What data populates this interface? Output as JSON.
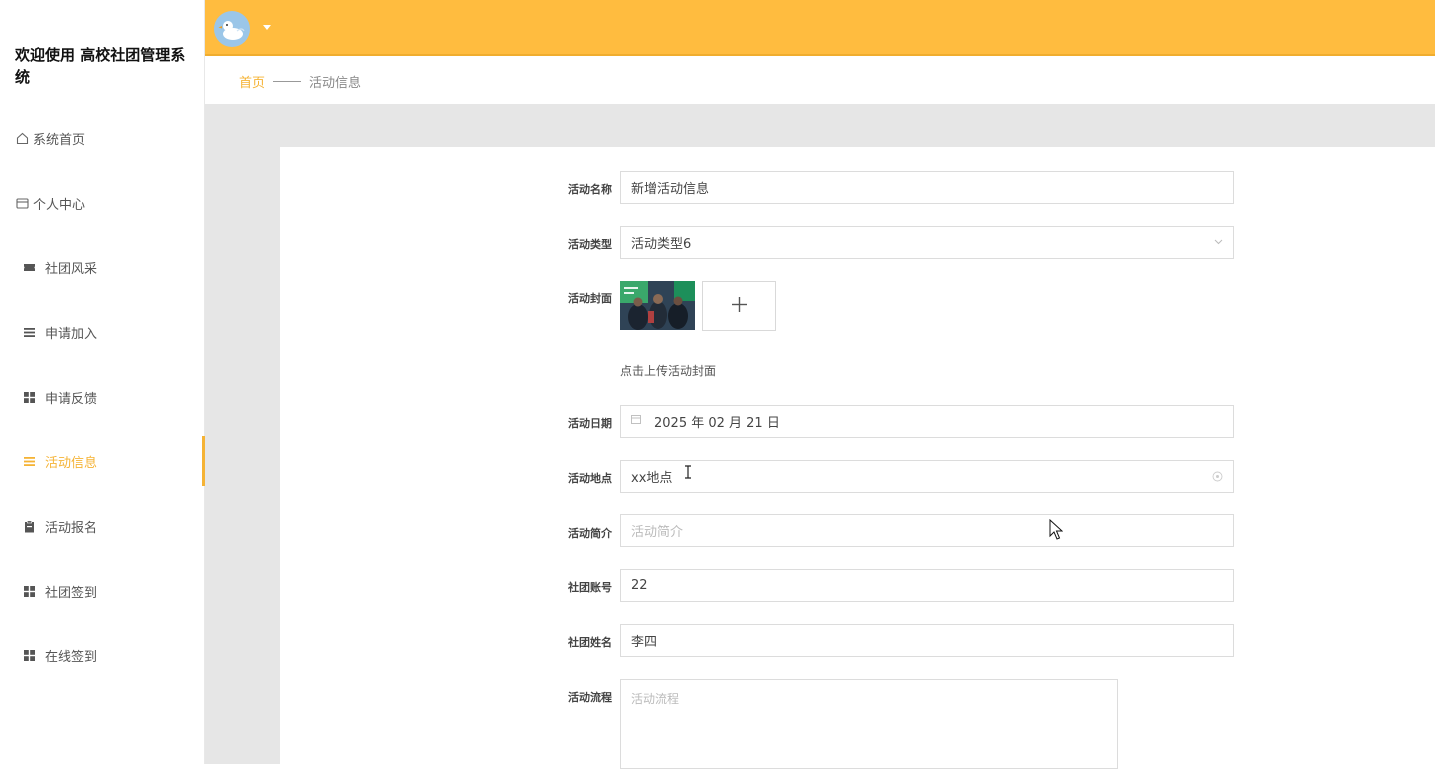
{
  "app": {
    "title": "欢迎使用 高校社团管理系统"
  },
  "sidebar": {
    "items": [
      {
        "label": "系统首页",
        "icon": "home-icon"
      },
      {
        "label": "个人中心",
        "icon": "id-card-icon"
      },
      {
        "label": "社团风采",
        "icon": "ticket-icon"
      },
      {
        "label": "申请加入",
        "icon": "list-icon"
      },
      {
        "label": "申请反馈",
        "icon": "grid-icon"
      },
      {
        "label": "活动信息",
        "icon": "list-icon",
        "active": true
      },
      {
        "label": "活动报名",
        "icon": "clipboard-icon"
      },
      {
        "label": "社团签到",
        "icon": "grid-icon"
      },
      {
        "label": "在线签到",
        "icon": "grid-icon"
      }
    ]
  },
  "header": {
    "avatar_icon": "duck-avatar-icon",
    "dropdown_icon": "caret-down-icon"
  },
  "breadcrumb": {
    "home": "首页",
    "current": "活动信息"
  },
  "form": {
    "name": {
      "label": "活动名称",
      "value": "新增活动信息"
    },
    "type": {
      "label": "活动类型",
      "value": "活动类型6"
    },
    "cover": {
      "label": "活动封面",
      "hint": "点击上传活动封面"
    },
    "date": {
      "label": "活动日期",
      "value": "2025 年 02 月 21 日"
    },
    "location": {
      "label": "活动地点",
      "value": "xx地点"
    },
    "intro": {
      "label": "活动简介",
      "placeholder": "活动简介"
    },
    "club_account": {
      "label": "社团账号",
      "value": "22"
    },
    "club_name": {
      "label": "社团姓名",
      "value": "李四"
    },
    "process": {
      "label": "活动流程",
      "placeholder": "活动流程"
    }
  },
  "colors": {
    "accent": "#ffbc3f",
    "active_text": "#f5b335",
    "active_bg": "#fff4d9",
    "page_bg": "#e6e6e6"
  }
}
